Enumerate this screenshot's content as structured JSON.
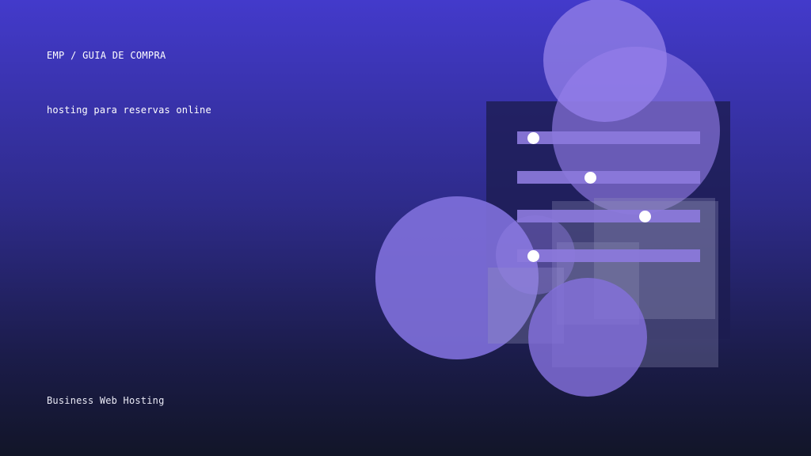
{
  "header": {
    "eyebrow": "EMP / GUIA DE COMPRA",
    "subtitle": "hosting para reservas online"
  },
  "footer": {
    "brand": "Business Web Hosting"
  },
  "illustration": {
    "sliders": [
      {
        "label": "",
        "level": 0.09
      },
      {
        "label": "",
        "level": 0.4
      },
      {
        "label": "",
        "level": 0.7
      },
      {
        "label": "",
        "level": 0.09
      }
    ],
    "colors": {
      "accent": "#8c7adc",
      "panel": "#1c1c50",
      "knob": "#ffffff"
    }
  }
}
